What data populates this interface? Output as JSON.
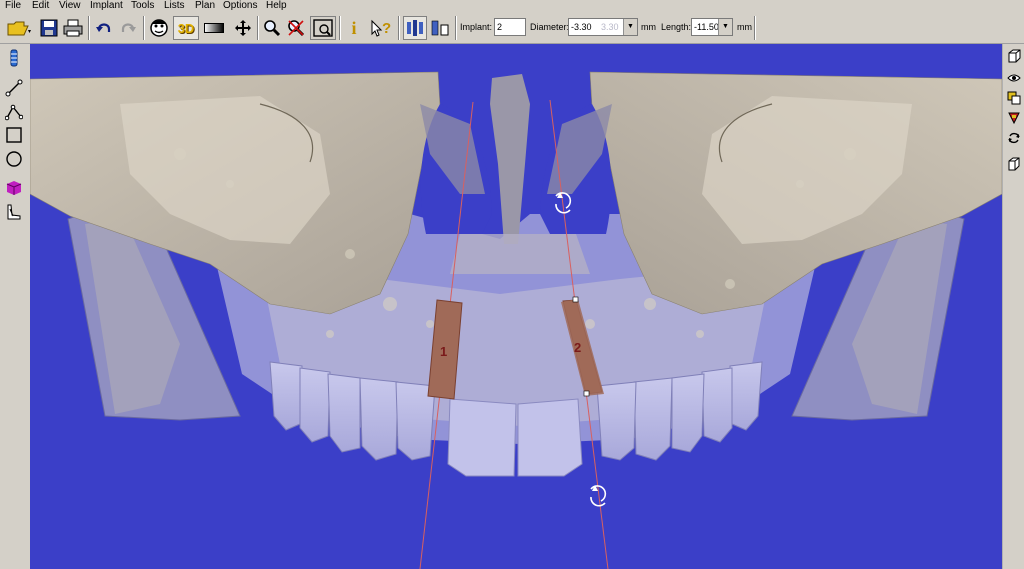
{
  "menu": {
    "file": "File",
    "edit": "Edit",
    "view": "View",
    "implant": "Implant",
    "tools": "Tools",
    "lists": "Lists",
    "plan": "Plan",
    "options": "Options",
    "help": "Help"
  },
  "toolbar": {
    "three_d_label": "3D",
    "implant_label": "Implant:",
    "implant_value": "2",
    "diameter_label": "Diameter:",
    "diameter_value": "-3.30",
    "diameter_ghost": "3.30",
    "diameter_unit": "mm",
    "length_label": "Length:",
    "length_value": "-11.50",
    "length_unit": "mm"
  },
  "viewport": {
    "background_color": "#3b3fc8",
    "implants": [
      {
        "label": "1"
      },
      {
        "label": "2"
      }
    ]
  }
}
